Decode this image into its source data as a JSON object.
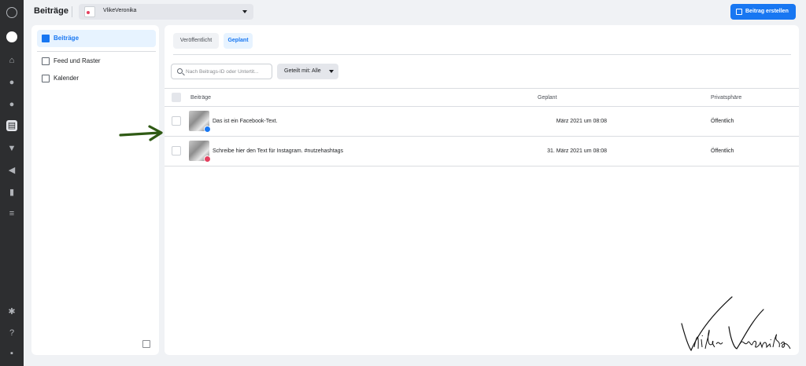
{
  "header": {
    "title": "Beiträge",
    "account_name": "VlikeVeronika",
    "create_button_label": "Beitrag erstellen"
  },
  "sidebar": {
    "items": [
      {
        "label": "Beiträge",
        "icon": "posts-icon",
        "active": true
      },
      {
        "label": "Feed und Raster",
        "icon": "feed-icon",
        "active": false
      },
      {
        "label": "Kalender",
        "icon": "calendar-icon",
        "active": false
      }
    ]
  },
  "rail": {
    "icons": [
      "meta-logo-icon",
      "avatar",
      "home-icon",
      "notifications-icon",
      "activity-icon",
      "content-icon",
      "shop-icon",
      "ads-icon",
      "insights-icon",
      "menu-icon",
      "settings-icon",
      "help-icon",
      "feedback-icon"
    ]
  },
  "main": {
    "tabs": [
      {
        "label": "Veröffentlicht",
        "active": false
      },
      {
        "label": "Geplant",
        "active": true
      }
    ],
    "search": {
      "placeholder": "Nach Beitrags-ID oder Untertit..."
    },
    "filter_label": "Geteilt mit: Alle",
    "table": {
      "columns": [
        "Beiträge",
        "Geplant",
        "Privatsphäre"
      ],
      "rows": [
        {
          "post": "Das ist ein Facebook-Text.",
          "platform": "facebook",
          "scheduled": "März 2021 um 08:08",
          "privacy": "Öffentlich"
        },
        {
          "post": "Schreibe hier den Text für Instagram. #nutzehashtags",
          "platform": "instagram",
          "scheduled": "31. März 2021 um 08:08",
          "privacy": "Öffentlich"
        }
      ]
    }
  },
  "annotation": {
    "arrow_color": "#2f5a14",
    "signature": "Vlike Veronika"
  },
  "colors": {
    "accent": "#1877f2",
    "rail": "#2d2e30",
    "background": "#f0f2f5"
  }
}
